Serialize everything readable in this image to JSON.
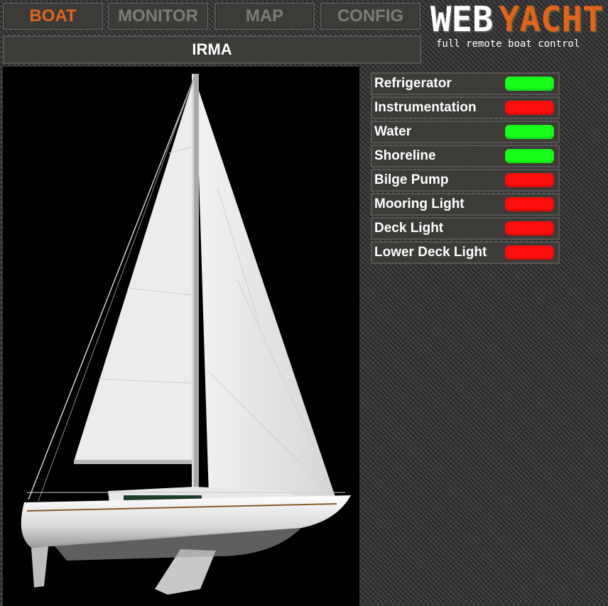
{
  "nav": {
    "tabs": [
      {
        "label": "BOAT",
        "active": true
      },
      {
        "label": "MONITOR",
        "active": false
      },
      {
        "label": "MAP",
        "active": false
      },
      {
        "label": "CONFIG",
        "active": false
      }
    ]
  },
  "logo": {
    "part1": "WEB",
    "part2": "YACHT",
    "tagline": "full remote boat control"
  },
  "boat": {
    "name": "IRMA",
    "image_icon": "sailboat-icon"
  },
  "colors": {
    "accent": "#e0641c",
    "status_on": "#19ff19",
    "status_off": "#ff0d0d",
    "panel_bg": "#3d3b38"
  },
  "systems": [
    {
      "label": "Refrigerator",
      "status": "on"
    },
    {
      "label": "Instrumentation",
      "status": "off"
    },
    {
      "label": "Water",
      "status": "on"
    },
    {
      "label": "Shoreline",
      "status": "on"
    },
    {
      "label": "Bilge Pump",
      "status": "off"
    },
    {
      "label": "Mooring Light",
      "status": "off"
    },
    {
      "label": "Deck Light",
      "status": "off"
    },
    {
      "label": "Lower Deck Light",
      "status": "off"
    }
  ]
}
